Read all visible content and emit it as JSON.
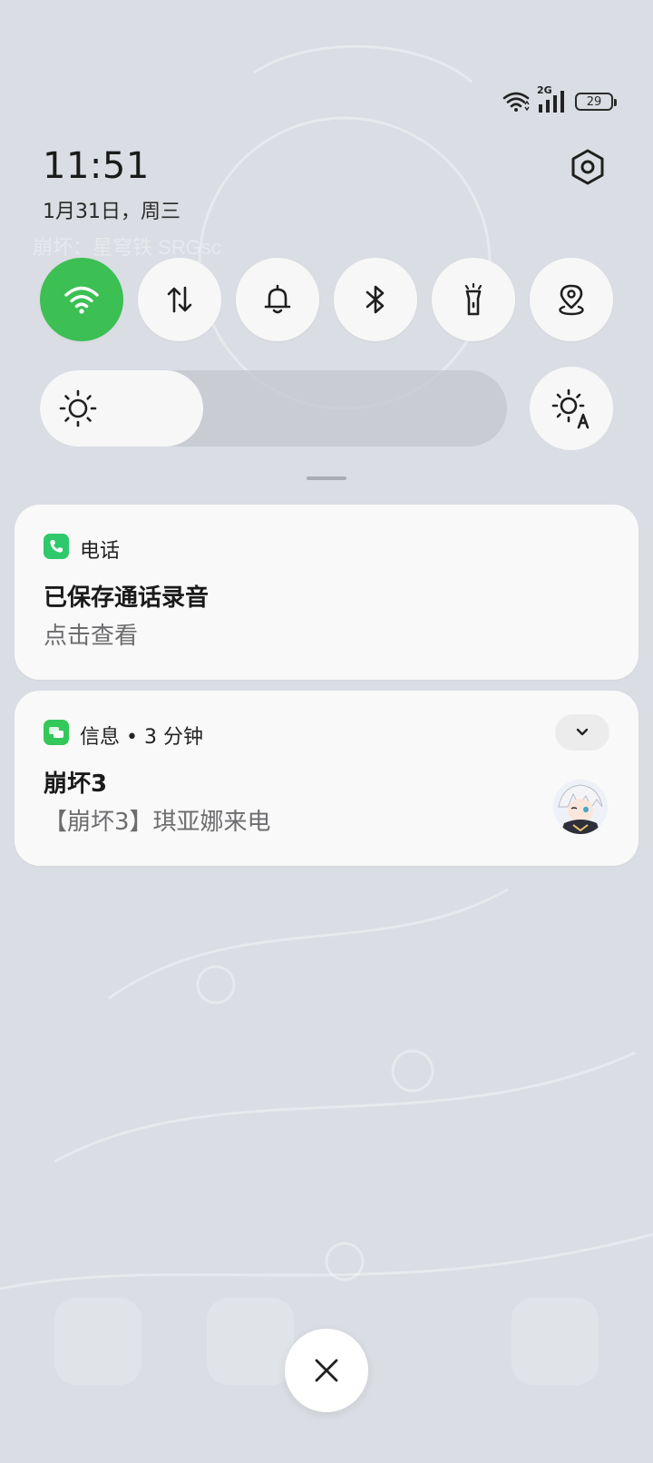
{
  "status_bar": {
    "network_type": "2G",
    "battery": "29",
    "icons": [
      "wifi-icon",
      "signal-icon",
      "battery-icon"
    ]
  },
  "header": {
    "time": "11:51",
    "date": "1月31日，周三"
  },
  "quick_settings": {
    "toggles": [
      {
        "name": "wifi",
        "icon": "wifi-icon",
        "active": true
      },
      {
        "name": "mobile-data",
        "icon": "data-arrows-icon",
        "active": false
      },
      {
        "name": "sound",
        "icon": "bell-icon",
        "active": false
      },
      {
        "name": "bluetooth",
        "icon": "bluetooth-icon",
        "active": false
      },
      {
        "name": "flashlight",
        "icon": "flashlight-icon",
        "active": false
      },
      {
        "name": "location",
        "icon": "location-icon",
        "active": false
      }
    ],
    "brightness_level": 0.35,
    "accent_color": "#3cbf53"
  },
  "notifications": [
    {
      "app": "电话",
      "title": "已保存通话录音",
      "body": "点击查看",
      "app_color": "#2ec96a"
    },
    {
      "app": "信息 • 3 分钟",
      "title": "崩坏3",
      "body": "【崩坏3】琪亚娜来电",
      "app_color": "#34c759"
    }
  ],
  "background": {
    "wallpaper_text": "崩坏：星穹铁  SRGsc"
  }
}
